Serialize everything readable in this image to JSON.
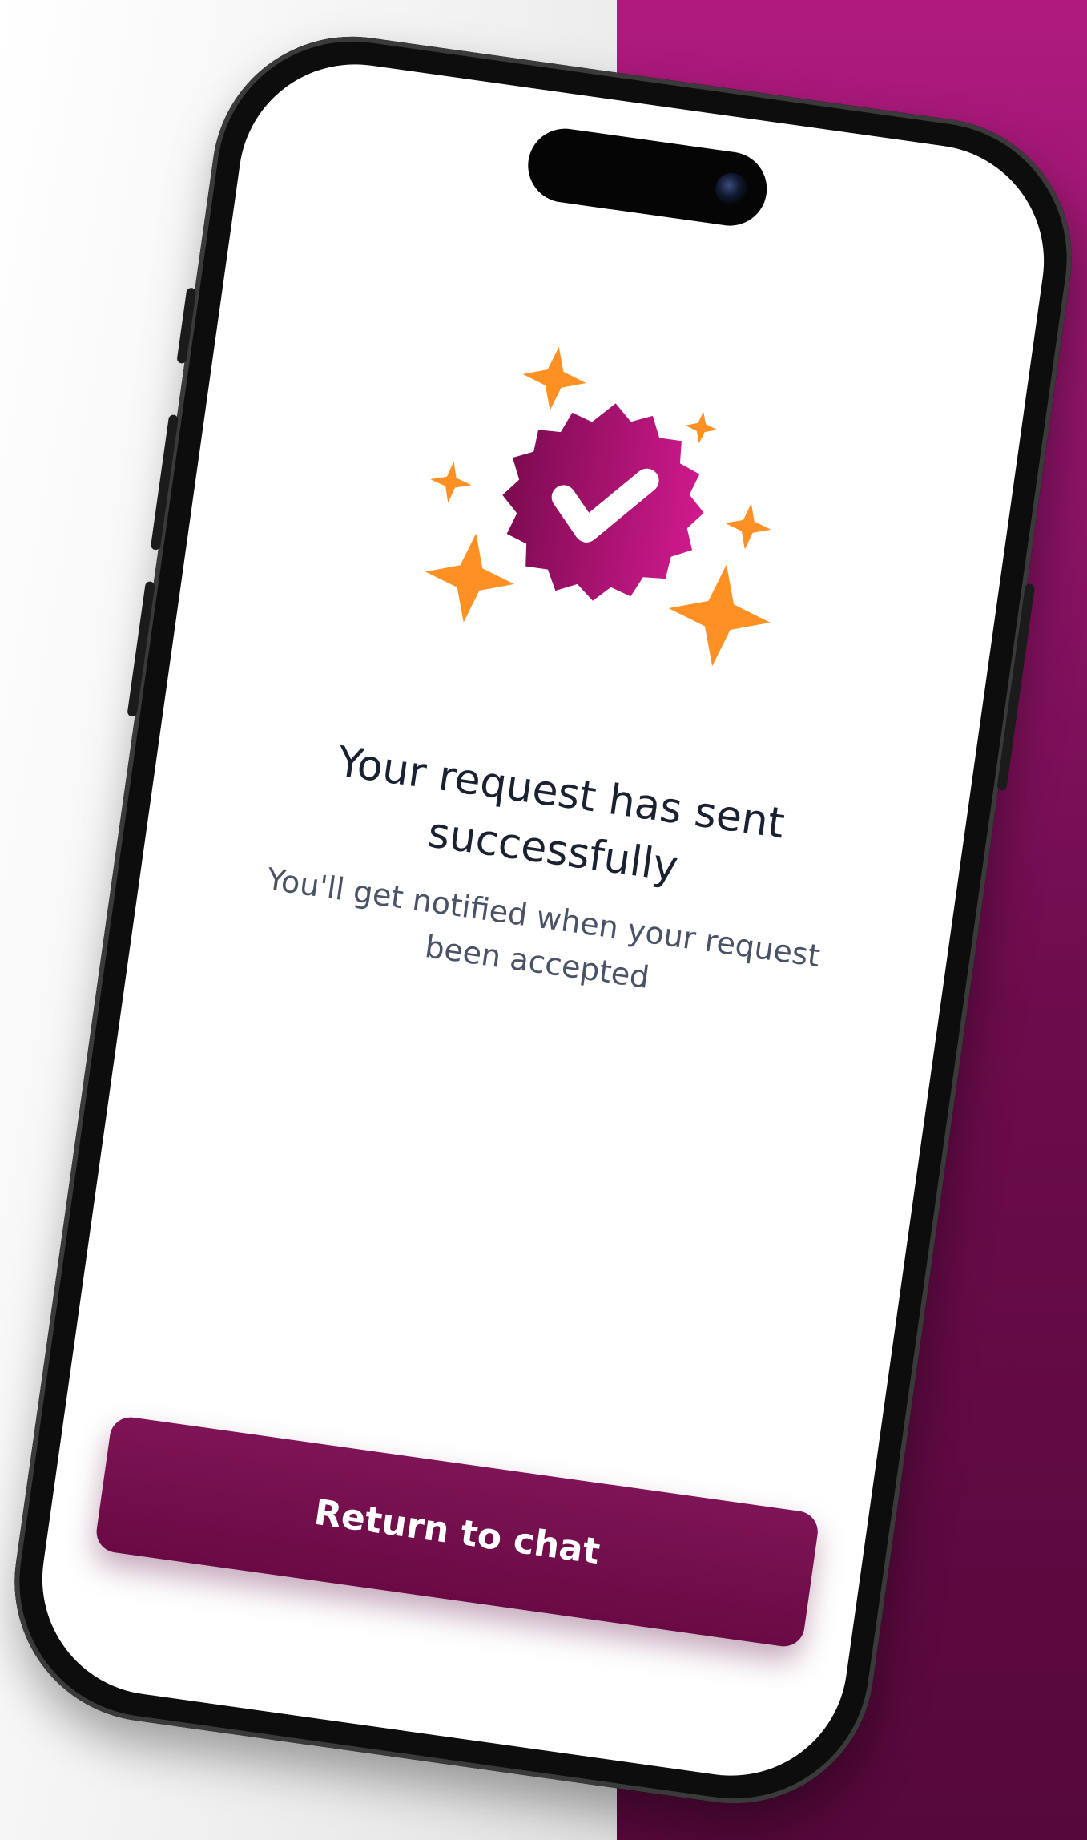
{
  "screen": {
    "title": "Your request has sent successfully",
    "subtitle": "You'll get notified when your request been accepted",
    "primary_button": "Return to chat"
  },
  "icons": {
    "badge": "verified-badge-icon",
    "sparkles": "sparkle-icon"
  },
  "colors": {
    "accent": "#a3127a",
    "button": "#6a0a44",
    "sparkle": "#ff9124",
    "background_right": "#8e1468"
  }
}
